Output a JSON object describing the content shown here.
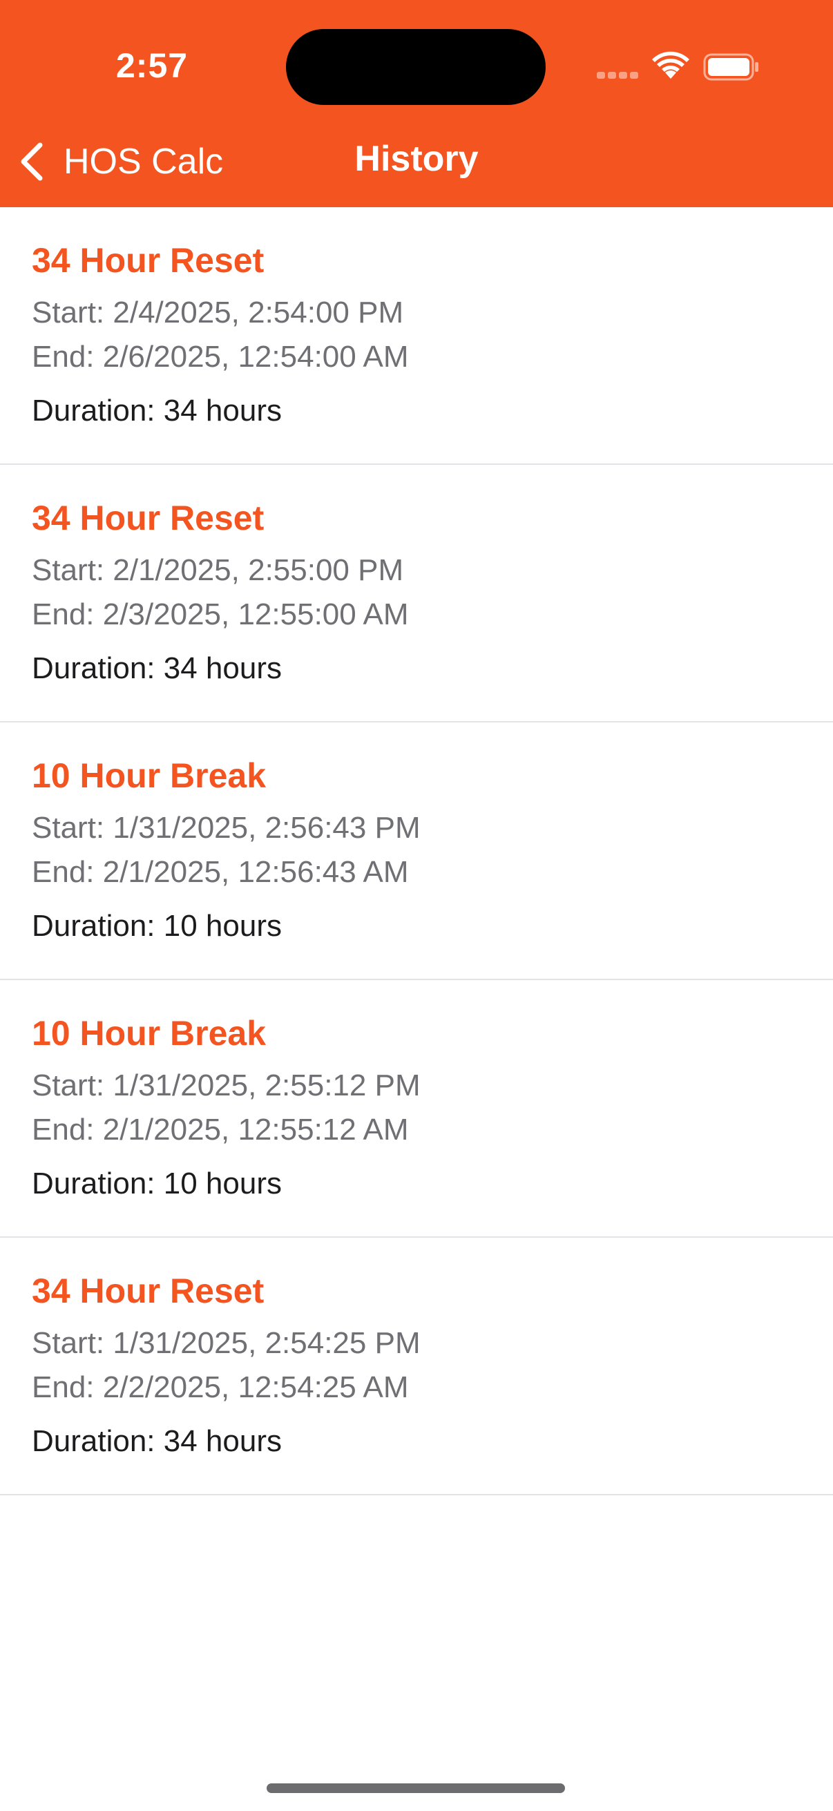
{
  "status_bar": {
    "time": "2:57"
  },
  "nav": {
    "back_label": "HOS Calc",
    "title": "History"
  },
  "colors": {
    "accent": "#F45420",
    "secondary_text": "#6f6f74",
    "primary_text": "#1c1c1e"
  },
  "icons": {
    "back": "chevron-left-icon",
    "wifi": "wifi-icon",
    "battery": "battery-icon"
  },
  "history": {
    "items": [
      {
        "title": "34 Hour Reset",
        "start": "Start: 2/4/2025, 2:54:00 PM",
        "end": "End: 2/6/2025, 12:54:00 AM",
        "duration": "Duration: 34 hours"
      },
      {
        "title": "34 Hour Reset",
        "start": "Start: 2/1/2025, 2:55:00 PM",
        "end": "End: 2/3/2025, 12:55:00 AM",
        "duration": "Duration: 34 hours"
      },
      {
        "title": "10 Hour Break",
        "start": "Start: 1/31/2025, 2:56:43 PM",
        "end": "End: 2/1/2025, 12:56:43 AM",
        "duration": "Duration: 10 hours"
      },
      {
        "title": "10 Hour Break",
        "start": "Start: 1/31/2025, 2:55:12 PM",
        "end": "End: 2/1/2025, 12:55:12 AM",
        "duration": "Duration: 10 hours"
      },
      {
        "title": "34 Hour Reset",
        "start": "Start: 1/31/2025, 2:54:25 PM",
        "end": "End: 2/2/2025, 12:54:25 AM",
        "duration": "Duration: 34 hours"
      }
    ]
  }
}
